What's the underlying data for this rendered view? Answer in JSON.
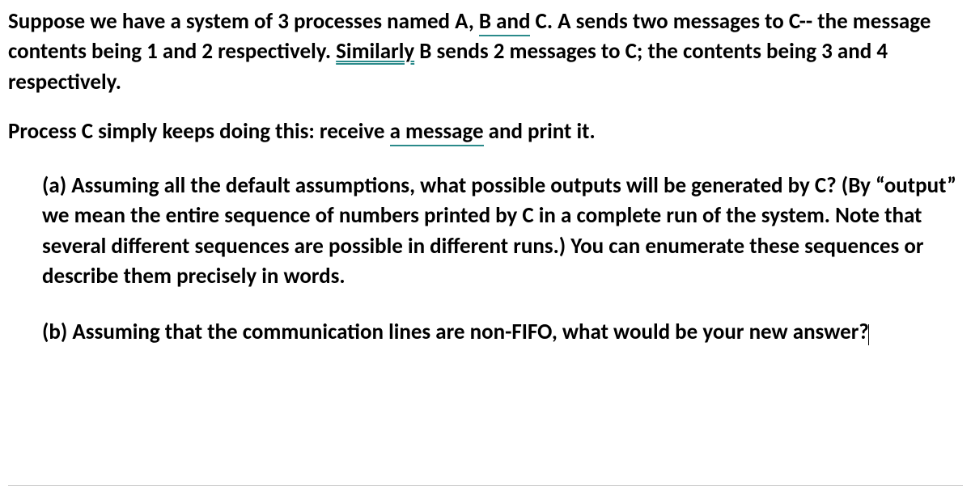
{
  "para1": {
    "t1": "Suppose we have a system of 3 processes named A, ",
    "u1": "B  and",
    "t2": " C. A sends two messages to C--  the message contents being 1 and 2 respectively. ",
    "u2": "Similarly",
    "t3": " B sends 2 messages to C; the contents being 3 and 4 respectively."
  },
  "para2": {
    "t1": "Process C simply keeps doing this: receive ",
    "u1": "a  message",
    "t2": " and print it."
  },
  "item_a": {
    "label": "(a) ",
    "text": "Assuming all the default assumptions, what possible outputs will be generated by C? (By “output” we mean the entire sequence of numbers printed by C in a complete run of the system. Note that several different sequences are possible in different runs.) You can enumerate these sequences or describe them precisely in words."
  },
  "item_b": {
    "label": "(b) ",
    "text": "Assuming that the communication lines are non-FIFO, what would be your new answer?"
  }
}
